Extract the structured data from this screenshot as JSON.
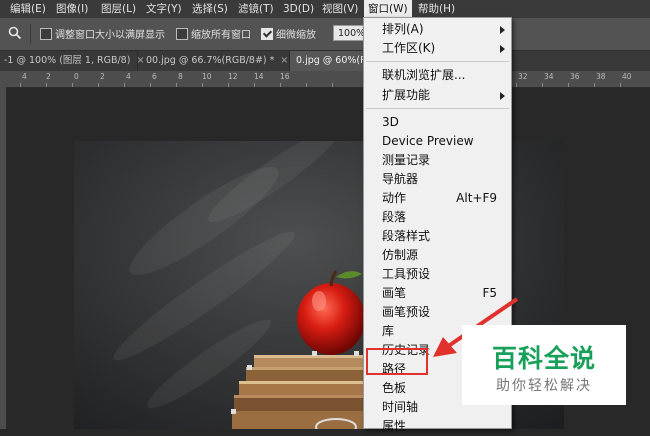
{
  "menubar": {
    "items": [
      "编辑(E)",
      "图像(I)",
      "图层(L)",
      "文字(Y)",
      "选择(S)",
      "滤镜(T)",
      "3D(D)",
      "视图(V)",
      "窗口(W)",
      "帮助(H)"
    ]
  },
  "options": {
    "resize_windows": "调整窗口大小以满屏显示",
    "zoom_all": "缩放所有窗口",
    "scrubby_zoom": "细微缩放",
    "zoom_value": "100%"
  },
  "tabs": [
    {
      "label": "-1 @ 100% (图层 1, RGB/8)",
      "close": "×"
    },
    {
      "label": "00.jpg @ 66.7%(RGB/8#) *",
      "close": "×"
    },
    {
      "label": "0.jpg @ 60%(R",
      "close": ""
    }
  ],
  "ruler": {
    "labels": [
      "4",
      "2",
      "0",
      "2",
      "4",
      "6",
      "8",
      "10",
      "12",
      "14",
      "16",
      "32",
      "34",
      "36",
      "38",
      "40"
    ]
  },
  "window_menu": {
    "arrange": "排列(A)",
    "workspace": "工作区(K)",
    "online_extensions": "联机浏览扩展...",
    "extension": "扩展功能",
    "threed": "3D",
    "device_preview": "Device Preview",
    "measurement_log": "测量记录",
    "navigator": "导航器",
    "actions": "动作",
    "actions_shortcut": "Alt+F9",
    "paragraph": "段落",
    "paragraph_styles": "段落样式",
    "clone_source": "仿制源",
    "tool_presets": "工具预设",
    "brush": "画笔",
    "brush_shortcut": "F5",
    "brush_presets": "画笔预设",
    "libraries": "库",
    "history": "历史记录",
    "paths": "路径",
    "swatches": "色板",
    "timeline": "时间轴",
    "properties": "属性"
  },
  "watermark": {
    "title": "百科全说",
    "subtitle": "助你轻松解决"
  },
  "colors": {
    "accent_red": "#e0312d",
    "watermark_green": "#18a05a"
  }
}
